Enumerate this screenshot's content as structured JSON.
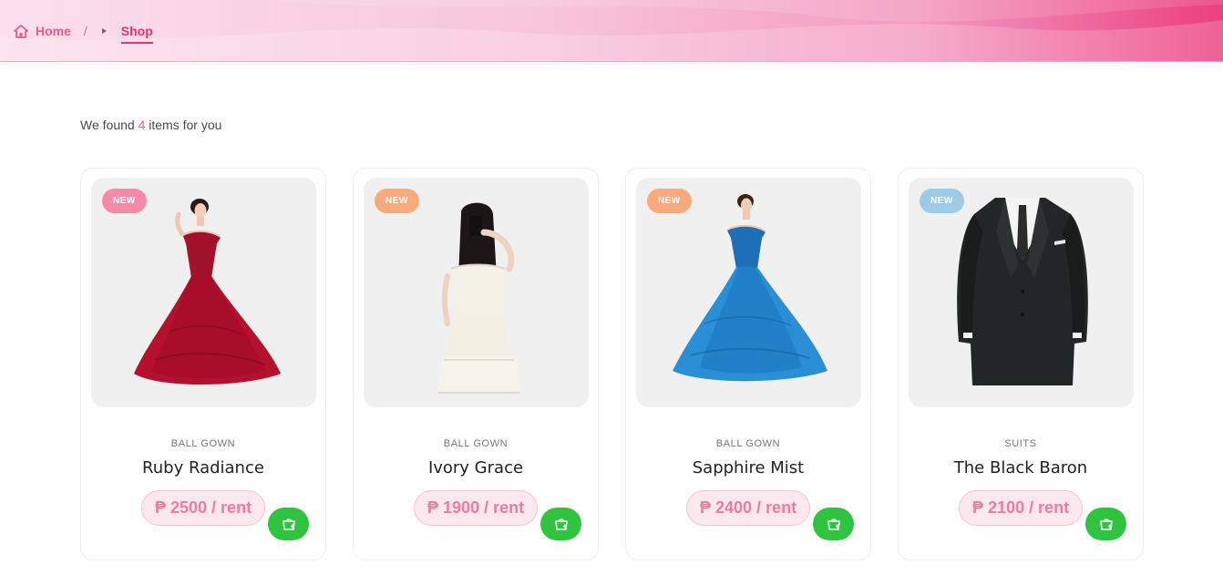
{
  "breadcrumb": {
    "home": "Home",
    "separator": "/",
    "current": "Shop"
  },
  "results": {
    "prefix": "We found",
    "count": "4",
    "suffix": "items for you"
  },
  "products": [
    {
      "badge": "NEW",
      "badge_color": "#f58aa8",
      "category": "BALL GOWN",
      "name": "Ruby Radiance",
      "price": "₱ 2500 / rent",
      "image": "red-ball-gown"
    },
    {
      "badge": "NEW",
      "badge_color": "#f9a97c",
      "category": "BALL GOWN",
      "name": "Ivory Grace",
      "price": "₱ 1900 / rent",
      "image": "white-dress"
    },
    {
      "badge": "NEW",
      "badge_color": "#f9a97c",
      "category": "BALL GOWN",
      "name": "Sapphire Mist",
      "price": "₱ 2400 / rent",
      "image": "blue-ball-gown"
    },
    {
      "badge": "NEW",
      "badge_color": "#9ccbe8",
      "category": "SUITS",
      "name": "The Black Baron",
      "price": "₱ 2100 / rent",
      "image": "black-suit"
    }
  ],
  "colors": {
    "accent": "#e0336f",
    "cart_button": "#2fc33f",
    "price_bg": "#fde8ee"
  }
}
